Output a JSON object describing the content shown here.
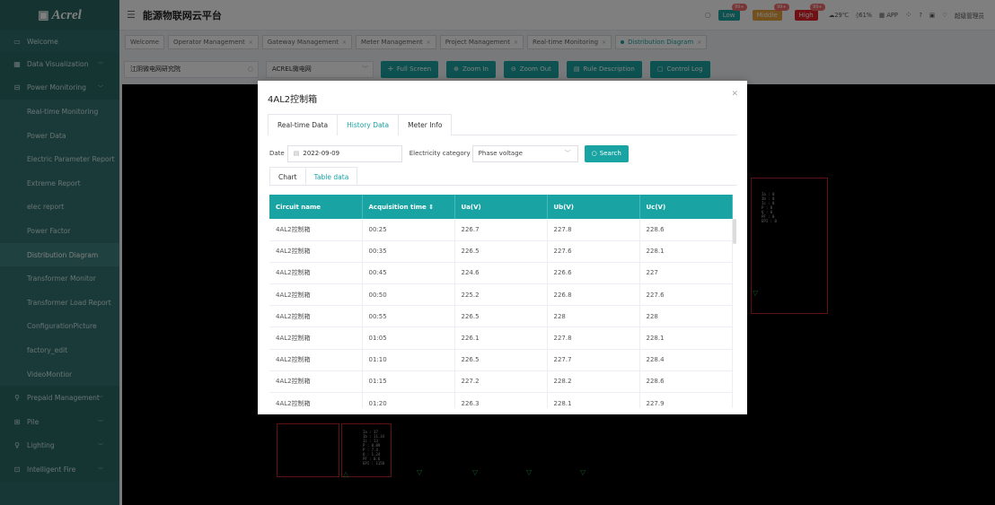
{
  "app": {
    "logo": "Acrel",
    "title": "能源物联网云平台"
  },
  "sidebar": {
    "items": [
      {
        "icon": "monitor-icon",
        "label": "Welcome",
        "kind": "welcome"
      },
      {
        "icon": "chart-icon",
        "label": "Data Visualization",
        "kind": "top"
      },
      {
        "icon": "power-icon",
        "label": "Power Monitoring",
        "kind": "top"
      },
      {
        "label": "Real-time Monitoring",
        "kind": "sub"
      },
      {
        "label": "Power Data",
        "kind": "sub"
      },
      {
        "label": "Electric Parameter Report",
        "kind": "sub"
      },
      {
        "label": "Extreme Report",
        "kind": "sub"
      },
      {
        "label": "elec report",
        "kind": "sub"
      },
      {
        "label": "Power Factor",
        "kind": "sub"
      },
      {
        "label": "Distribution Diagram",
        "kind": "sub",
        "active": true
      },
      {
        "label": "Transformer Monitor",
        "kind": "sub"
      },
      {
        "label": "Transformer Load Report",
        "kind": "sub"
      },
      {
        "label": "ConfigurationPicture",
        "kind": "sub"
      },
      {
        "label": "factory_edit",
        "kind": "sub"
      },
      {
        "label": "VideoMontior",
        "kind": "sub"
      },
      {
        "icon": "prepaid-icon",
        "label": "Prepaid Management",
        "kind": "top"
      },
      {
        "icon": "pile-icon",
        "label": "Pile",
        "kind": "top"
      },
      {
        "icon": "lighting-icon",
        "label": "Lighting",
        "kind": "top"
      },
      {
        "icon": "fire-icon",
        "label": "Intelligent Fire",
        "kind": "top"
      }
    ]
  },
  "header": {
    "alarms": [
      {
        "label": "Low",
        "badge": "99+",
        "color": "#1aa3a3"
      },
      {
        "label": "Middle",
        "badge": "99+",
        "color": "#e6a23c"
      },
      {
        "label": "High",
        "badge": "99+",
        "color": "#e2232a"
      }
    ],
    "weather": "29℃",
    "humidity": "61%",
    "app_label": "APP",
    "user": "超级管理员"
  },
  "tabs": [
    {
      "label": "Welcome"
    },
    {
      "label": "Operator Management"
    },
    {
      "label": "Gateway Management"
    },
    {
      "label": "Meter Management"
    },
    {
      "label": "Project Management"
    },
    {
      "label": "Real-time Monitoring"
    },
    {
      "label": "Distribution Diagram",
      "active": true
    }
  ],
  "toolbar": {
    "org": "江阴微电网研究院",
    "station": "ACREL微电网",
    "buttons": [
      "Full Screen",
      "Zoom In",
      "Zoom Out",
      "Rule Description",
      "Control Log"
    ]
  },
  "modal": {
    "title": "4AL2控制箱",
    "tabs": [
      "Real-time Data",
      "History Data",
      "Meter Info"
    ],
    "active_tab": "History Data",
    "date_label": "Date",
    "date_value": "2022-09-09",
    "category_label": "Electricity category",
    "category_value": "Phase voltage",
    "search_label": "Search",
    "subtabs": [
      "Chart",
      "Table data"
    ],
    "active_subtab": "Table data",
    "columns": [
      "Circuit name",
      "Acquisition time ⇕",
      "Ua(V)",
      "Ub(V)",
      "Uc(V)"
    ],
    "rows": [
      [
        "4AL2控制箱",
        "00:25",
        "226.7",
        "227.8",
        "228.6"
      ],
      [
        "4AL2控制箱",
        "00:35",
        "226.5",
        "227.6",
        "228.1"
      ],
      [
        "4AL2控制箱",
        "00:45",
        "224.6",
        "226.6",
        "227"
      ],
      [
        "4AL2控制箱",
        "00:50",
        "225.2",
        "226.8",
        "227.6"
      ],
      [
        "4AL2控制箱",
        "00:55",
        "226.5",
        "228",
        "228"
      ],
      [
        "4AL2控制箱",
        "01:05",
        "226.1",
        "227.8",
        "228.1"
      ],
      [
        "4AL2控制箱",
        "01:10",
        "226.5",
        "227.7",
        "228.4"
      ],
      [
        "4AL2控制箱",
        "01:15",
        "227.2",
        "228.2",
        "228.6"
      ],
      [
        "4AL2控制箱",
        "01:20",
        "226.3",
        "228.1",
        "227.9"
      ]
    ]
  }
}
